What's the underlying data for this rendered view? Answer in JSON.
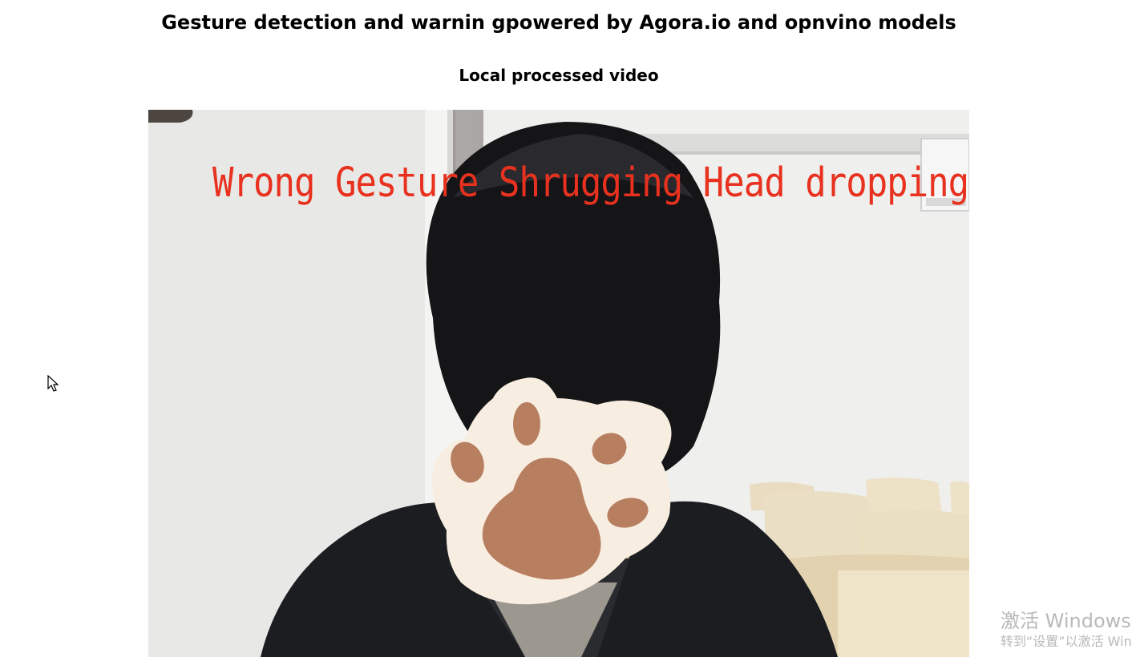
{
  "page": {
    "title": "Gesture detection and warnin gpowered by Agora.io and opnvino models",
    "section_title": "Local processed video"
  },
  "video": {
    "overlay_text": "Wrong Gesture Shrugging Head dropping",
    "overlay_color": "#e8311e",
    "face_cover_icon": "paw-print-icon"
  },
  "cursor": {
    "icon": "mouse-pointer-icon"
  },
  "watermark": {
    "line1": "激活 Windows",
    "line2": "转到“设置”以激活 Windows。"
  }
}
